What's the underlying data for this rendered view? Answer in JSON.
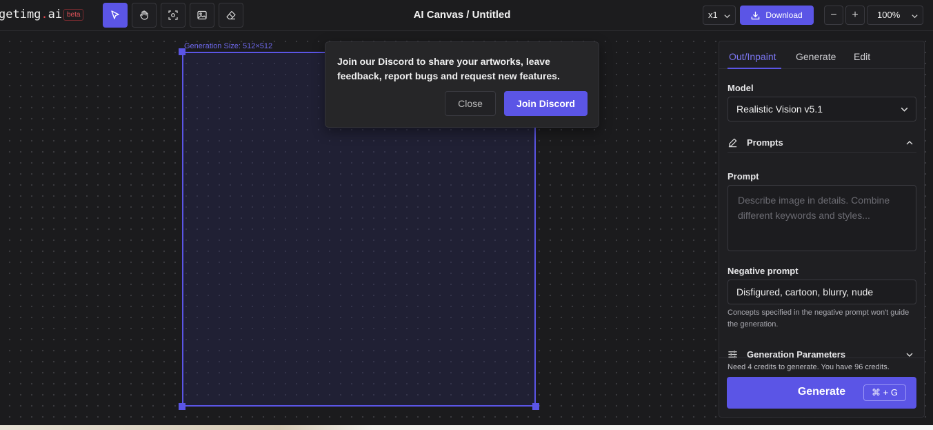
{
  "app": {
    "logo_text": "getimg",
    "logo_dot": ".",
    "logo_suffix": "ai",
    "beta_badge": "beta",
    "title": "AI Canvas / Untitled"
  },
  "toolbar": {
    "tools": [
      {
        "name": "select-tool",
        "icon": "cursor-icon",
        "active": true
      },
      {
        "name": "pan-tool",
        "icon": "hand-icon",
        "active": false
      },
      {
        "name": "frame-tool",
        "icon": "focus-frame-icon",
        "active": false
      },
      {
        "name": "image-tool",
        "icon": "image-icon",
        "active": false
      },
      {
        "name": "eraser-tool",
        "icon": "eraser-icon",
        "active": false
      }
    ],
    "multiplier": "x1",
    "download_label": "Download",
    "zoom_out": "−",
    "zoom_in": "+",
    "zoom_level": "100%"
  },
  "canvas": {
    "generation_size_label": "Generation Size: 512×512"
  },
  "popup": {
    "message": "Join our Discord to share your artworks, leave feedback, report bugs and request new features.",
    "close_label": "Close",
    "join_label": "Join Discord"
  },
  "panel": {
    "tabs": [
      {
        "label": "Out/Inpaint",
        "active": true
      },
      {
        "label": "Generate",
        "active": false
      },
      {
        "label": "Edit",
        "active": false
      }
    ],
    "model_label": "Model",
    "model_value": "Realistic Vision v5.1",
    "prompts_section": "Prompts",
    "prompt_label": "Prompt",
    "prompt_placeholder": "Describe image in details. Combine different keywords and styles...",
    "negative_label": "Negative prompt",
    "negative_value": "Disfigured, cartoon, blurry, nude",
    "negative_hint": "Concepts specified in the negative prompt won't guide the generation.",
    "params_section": "Generation Parameters",
    "credits_text": "Need 4 credits to generate. You have 96 credits.",
    "generate_label": "Generate",
    "generate_shortcut": "⌘ + G"
  },
  "colors": {
    "accent": "#5b55e6",
    "background": "#1b1b1d",
    "panel": "#1f1f22",
    "beta_red": "#e5545b"
  }
}
